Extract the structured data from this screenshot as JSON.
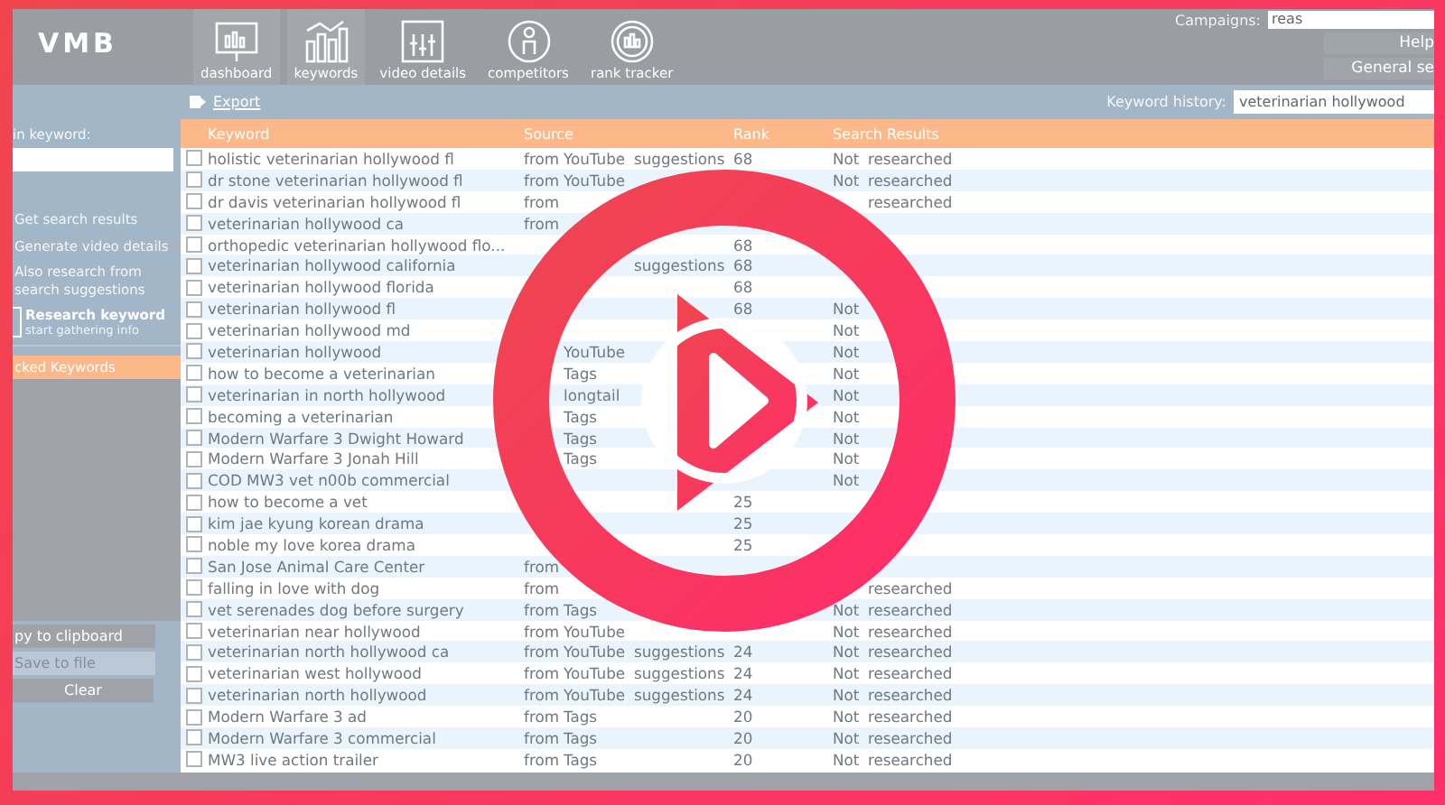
{
  "app": {
    "logo": "VMB",
    "nav": [
      {
        "label": "dashboard"
      },
      {
        "label": "keywords"
      },
      {
        "label": "video details"
      },
      {
        "label": "competitors"
      },
      {
        "label": "rank tracker"
      }
    ],
    "campaigns": {
      "label": "Campaigns:",
      "value": "reas"
    },
    "header_buttons": [
      "Help",
      "General se"
    ]
  },
  "toolbar": {
    "export": "Export",
    "history_label": "Keyword history:",
    "history_value": "veterinarian hollywood"
  },
  "sidebar": {
    "keyword_label": "in keyword:",
    "options": [
      "Get search results",
      "Generate video details",
      "Also research from search suggestions"
    ],
    "research": {
      "title": "Research keyword",
      "subtitle": "start gathering info"
    },
    "section": "cked Keywords",
    "buttons": [
      {
        "label": "py to clipboard",
        "disabled": false
      },
      {
        "label": "Save to file",
        "disabled": true
      },
      {
        "label": "Clear",
        "disabled": false
      }
    ]
  },
  "table": {
    "columns": [
      "Keyword",
      "Source",
      "Rank",
      "Search Results"
    ],
    "rows": [
      {
        "checked": false,
        "keyword": "holistic veterinarian hollywood fl",
        "source": {
          "word_1": "from",
          "word_2": "YouTube",
          "word_3": "suggestions"
        },
        "rank": "68",
        "results": {
          "word_1": "Not",
          "word_2": "researched"
        }
      },
      {
        "checked": false,
        "keyword": "dr stone veterinarian hollywood fl",
        "source": {
          "word_1": "from",
          "word_2": "YouTube"
        },
        "results": {
          "word_1": "Not",
          "word_2": "researched"
        }
      },
      {
        "checked": false,
        "keyword": "dr davis veterinarian hollywood fl",
        "source": {
          "word_1": "from"
        },
        "results": {
          "word_2": "researched"
        }
      },
      {
        "checked": false,
        "keyword": "veterinarian hollywood ca",
        "source": {
          "word_1": "from"
        }
      },
      {
        "checked": false,
        "keyword": "orthopedic veterinarian hollywood flo...",
        "rank": "68"
      },
      {
        "checked": false,
        "keyword": "veterinarian hollywood california",
        "source": {
          "word_3": "suggestions"
        },
        "rank": "68"
      },
      {
        "checked": false,
        "keyword": "veterinarian hollywood florida",
        "rank": "68"
      },
      {
        "checked": false,
        "keyword": "veterinarian hollywood fl",
        "rank": "68",
        "results": {
          "word_1": "Not"
        }
      },
      {
        "checked": false,
        "keyword": "veterinarian hollywood md",
        "results": {
          "word_1": "Not"
        }
      },
      {
        "checked": false,
        "keyword": "veterinarian hollywood",
        "source": {
          "word_2": "YouTube"
        },
        "results": {
          "word_1": "Not"
        }
      },
      {
        "checked": false,
        "keyword": "how to become a veterinarian",
        "source": {
          "word_2": "Tags"
        },
        "results": {
          "word_1": "Not"
        }
      },
      {
        "checked": false,
        "keyword": "veterinarian in north hollywood",
        "source": {
          "word_2": "longtail"
        },
        "results": {
          "word_1": "Not"
        }
      },
      {
        "checked": false,
        "keyword": "becoming a veterinarian",
        "source": {
          "word_2": "Tags"
        },
        "results": {
          "word_1": "Not"
        }
      },
      {
        "checked": false,
        "keyword": "Modern Warfare 3 Dwight Howard",
        "source": {
          "word_2": "Tags"
        },
        "results": {
          "word_1": "Not"
        }
      },
      {
        "checked": false,
        "keyword": "Modern Warfare 3 Jonah Hill",
        "source": {
          "word_2": "Tags"
        },
        "results": {
          "word_1": "Not"
        }
      },
      {
        "checked": false,
        "keyword": "COD MW3 vet n00b commercial",
        "results": {
          "word_1": "Not"
        }
      },
      {
        "checked": false,
        "keyword": "how to become a vet",
        "rank": "25"
      },
      {
        "checked": false,
        "keyword": "kim jae kyung korean drama",
        "rank": "25"
      },
      {
        "checked": false,
        "keyword": "noble my love korea drama",
        "rank": "25"
      },
      {
        "checked": false,
        "keyword": "San Jose Animal Care Center",
        "source": {
          "word_1": "from"
        }
      },
      {
        "checked": false,
        "keyword": "falling in love with dog",
        "source": {
          "word_1": "from"
        },
        "results": {
          "word_2": "researched"
        }
      },
      {
        "checked": false,
        "keyword": "vet serenades dog before surgery",
        "source": {
          "word_1": "from",
          "word_2": "Tags"
        },
        "results": {
          "word_1": "Not",
          "word_2": "researched"
        }
      },
      {
        "checked": false,
        "keyword": "veterinarian near hollywood",
        "source": {
          "word_1": "from",
          "word_2": "YouTube"
        },
        "results": {
          "word_1": "Not",
          "word_2": "researched"
        }
      },
      {
        "checked": false,
        "keyword": "veterinarian north hollywood ca",
        "source": {
          "word_1": "from",
          "word_2": "YouTube",
          "word_3": "suggestions"
        },
        "rank": "24",
        "results": {
          "word_1": "Not",
          "word_2": "researched"
        }
      },
      {
        "checked": false,
        "keyword": "veterinarian west hollywood",
        "source": {
          "word_1": "from",
          "word_2": "YouTube",
          "word_3": "suggestions"
        },
        "rank": "24",
        "results": {
          "word_1": "Not",
          "word_2": "researched"
        }
      },
      {
        "checked": false,
        "keyword": "veterinarian north hollywood",
        "source": {
          "word_1": "from",
          "word_2": "YouTube",
          "word_3": "suggestions"
        },
        "rank": "24",
        "results": {
          "word_1": "Not",
          "word_2": "researched"
        }
      },
      {
        "checked": false,
        "keyword": "Modern Warfare 3 ad",
        "source": {
          "word_1": "from",
          "word_2": "Tags"
        },
        "rank": "20",
        "results": {
          "word_1": "Not",
          "word_2": "researched"
        }
      },
      {
        "checked": false,
        "keyword": "Modern Warfare 3 commercial",
        "source": {
          "word_1": "from",
          "word_2": "Tags"
        },
        "rank": "20",
        "results": {
          "word_1": "Not",
          "word_2": "researched"
        }
      },
      {
        "checked": false,
        "keyword": "MW3 live action trailer",
        "source": {
          "word_1": "from",
          "word_2": "Tags"
        },
        "rank": "20",
        "results": {
          "word_1": "Not",
          "word_2": "researched"
        }
      }
    ]
  }
}
